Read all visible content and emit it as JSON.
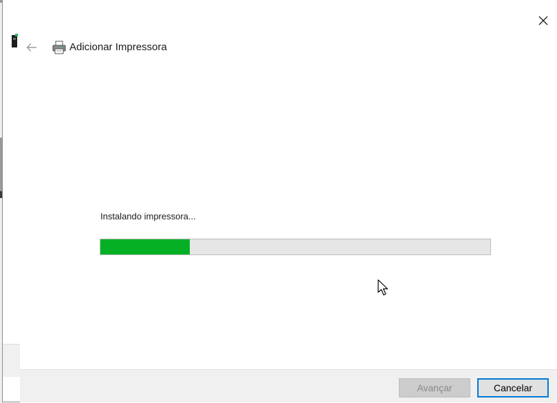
{
  "dialog": {
    "title": "Adicionar Impressora",
    "close_icon": "close-icon",
    "back_icon": "back-arrow-icon",
    "title_icon": "printer-icon"
  },
  "install": {
    "status": "Instalando impressora...",
    "progress_fraction": 0.23,
    "progress_color": "#06b025"
  },
  "buttons": {
    "next_label": "Avançar",
    "cancel_label": "Cancelar"
  },
  "colors": {
    "accent": "#0078d7",
    "progress": "#06b025"
  }
}
